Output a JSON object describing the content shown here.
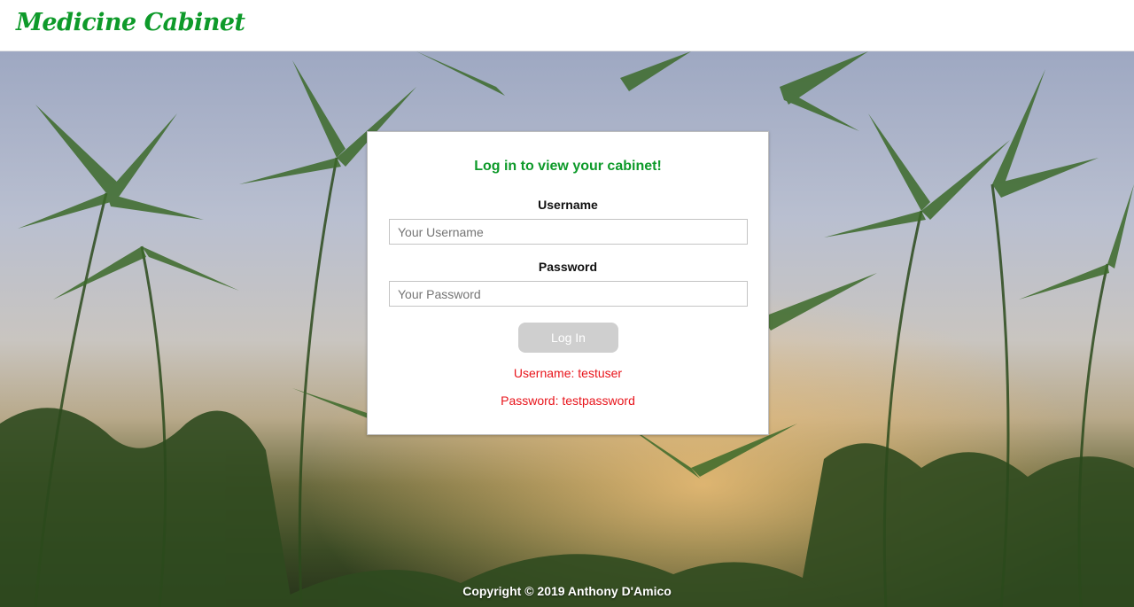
{
  "header": {
    "brand": "Medicine Cabinet"
  },
  "login": {
    "title": "Log in to view your cabinet!",
    "username_label": "Username",
    "username_placeholder": "Your Username",
    "password_label": "Password",
    "password_placeholder": "Your Password",
    "submit_label": "Log In",
    "hint_username": "Username: testuser",
    "hint_password": "Password: testpassword"
  },
  "footer": {
    "copyright": "Copyright © 2019 Anthony D'Amico"
  },
  "colors": {
    "brand_green": "#0e9a2a",
    "hint_red": "#e8141b",
    "button_disabled": "#cfcfcf"
  }
}
